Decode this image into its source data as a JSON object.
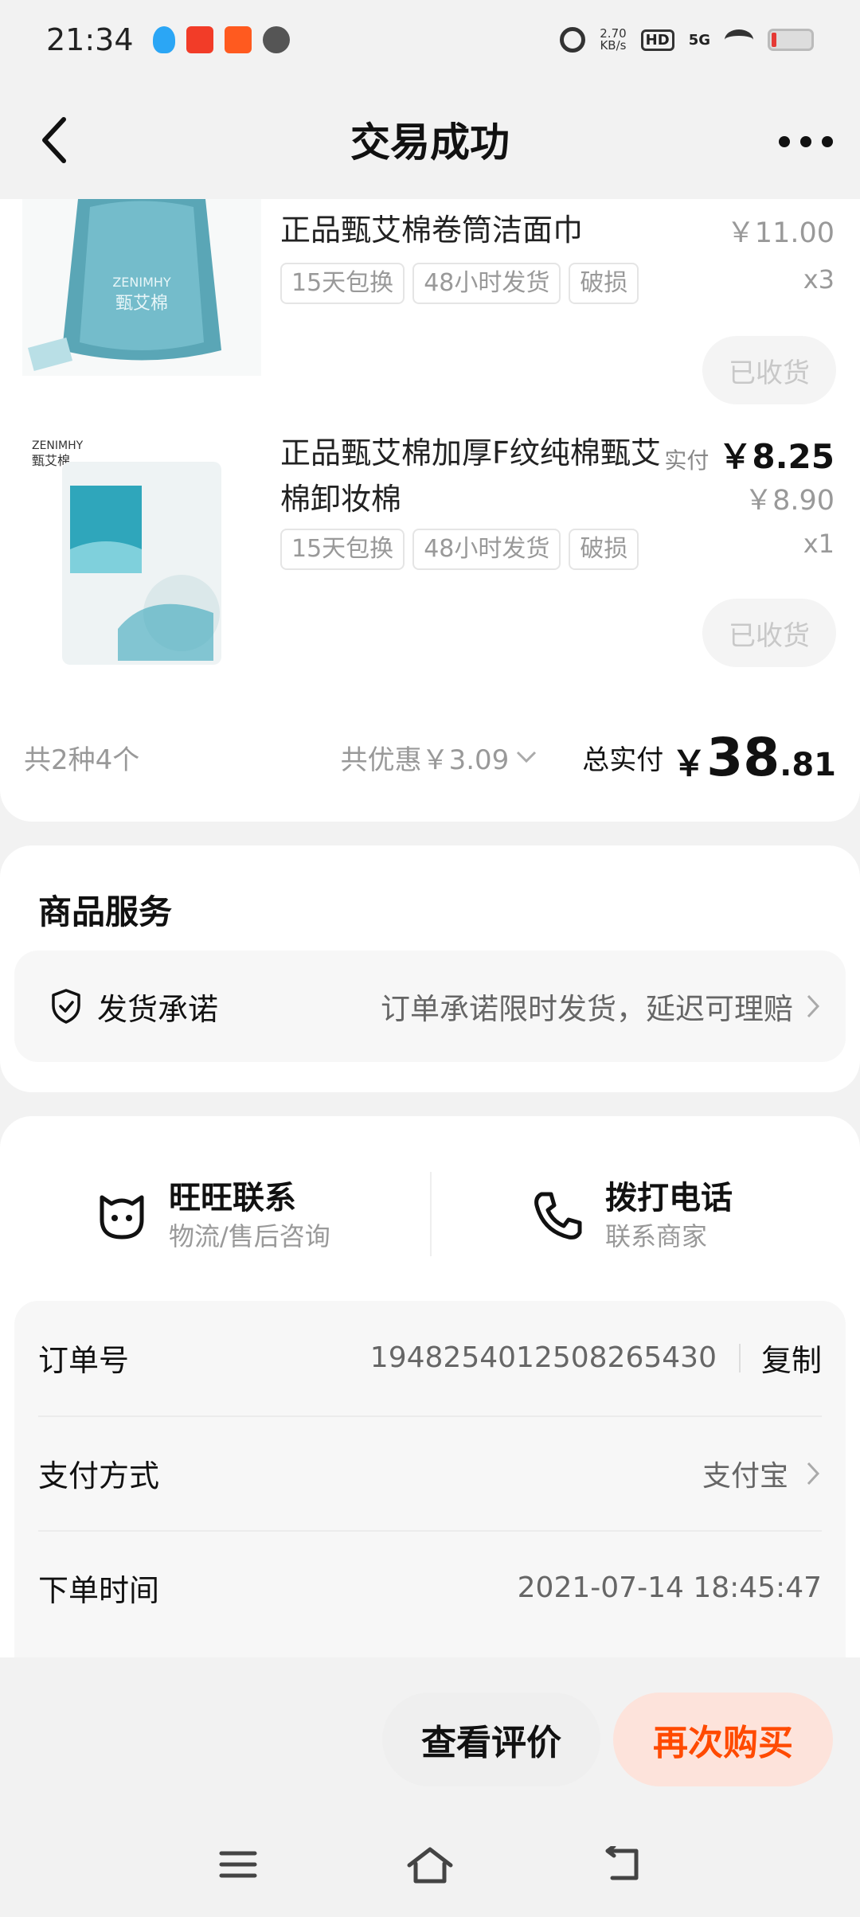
{
  "status_bar": {
    "time": "21:34",
    "net_speed": "2.70",
    "net_unit": "KB/s",
    "hd": "HD",
    "signal": "5G",
    "icons": [
      "qq-icon",
      "pinduoduo-icon",
      "taobao-icon",
      "wechat-icon",
      "alarm-icon",
      "wifi-icon",
      "battery-icon"
    ]
  },
  "header": {
    "title": "交易成功"
  },
  "products": [
    {
      "title": "正品甄艾棉卷筒洁面巾",
      "tags": [
        "15天包换",
        "48小时发货",
        "破损"
      ],
      "price": "￥11.00",
      "qty": "x3",
      "status": "已收货"
    },
    {
      "title": "正品甄艾棉加厚F纹纯棉甄艾棉卸妆棉",
      "tags": [
        "15天包换",
        "48小时发货",
        "破损"
      ],
      "paid_label": "实付",
      "paid_value": "￥8.25",
      "price": "￥8.90",
      "qty": "x1",
      "status": "已收货"
    }
  ],
  "summary": {
    "count": "共2种4个",
    "discount": "共优惠￥3.09",
    "total_label": "总实付",
    "total_yen": "￥",
    "total_int": "38",
    "total_dec": ".81"
  },
  "services": {
    "title": "商品服务",
    "item_name": "发货承诺",
    "item_desc": "订单承诺限时发货，延迟可理赔"
  },
  "contact": {
    "wangwang_title": "旺旺联系",
    "wangwang_sub": "物流/售后咨询",
    "phone_title": "拨打电话",
    "phone_sub": "联系商家"
  },
  "order_info": {
    "order_no_label": "订单号",
    "order_no": "1948254012508265430",
    "copy_label": "复制",
    "payment_label": "支付方式",
    "payment_value": "支付宝",
    "time_label": "下单时间",
    "time_value": "2021-07-14 18:45:47"
  },
  "actions": {
    "review": "查看评价",
    "rebuy": "再次购买"
  },
  "colors": {
    "accent": "#ff4a00",
    "rebuy_bg": "#fde3db",
    "background": "#f2f2f2"
  }
}
